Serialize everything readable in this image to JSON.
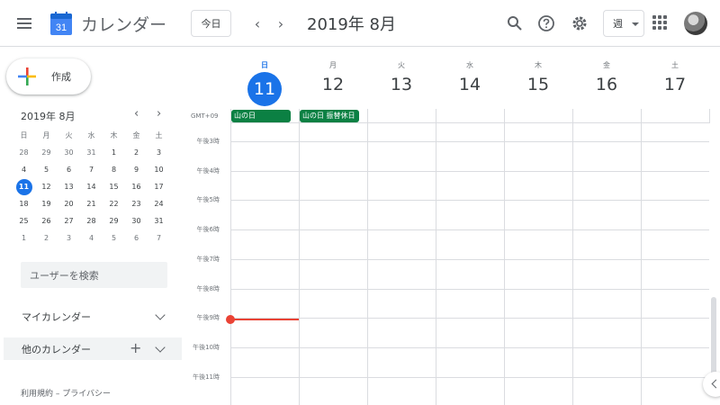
{
  "header": {
    "app_title": "カレンダー",
    "logo_day": "31",
    "today_label": "今日",
    "month_title": "2019年 8月",
    "view_label": "週",
    "logo_color": "#4285f4"
  },
  "sidebar": {
    "create_label": "作成",
    "mini_month": "2019年 8月",
    "weekdays": [
      "日",
      "月",
      "火",
      "水",
      "木",
      "金",
      "土"
    ],
    "weeks": [
      [
        "28",
        "29",
        "30",
        "31",
        "1",
        "2",
        "3"
      ],
      [
        "4",
        "5",
        "6",
        "7",
        "8",
        "9",
        "10"
      ],
      [
        "11",
        "12",
        "13",
        "14",
        "15",
        "16",
        "17"
      ],
      [
        "18",
        "19",
        "20",
        "21",
        "22",
        "23",
        "24"
      ],
      [
        "25",
        "26",
        "27",
        "28",
        "29",
        "30",
        "31"
      ],
      [
        "1",
        "2",
        "3",
        "4",
        "5",
        "6",
        "7"
      ]
    ],
    "today": "11",
    "search_placeholder": "ユーザーを検索",
    "my_calendars": "マイカレンダー",
    "other_calendars": "他のカレンダー",
    "footer": "利用規約 – プライバシー"
  },
  "week": {
    "days": [
      {
        "wd": "日",
        "dn": "11",
        "today": true
      },
      {
        "wd": "月",
        "dn": "12"
      },
      {
        "wd": "火",
        "dn": "13"
      },
      {
        "wd": "水",
        "dn": "14"
      },
      {
        "wd": "木",
        "dn": "15"
      },
      {
        "wd": "金",
        "dn": "16"
      },
      {
        "wd": "土",
        "dn": "17"
      }
    ],
    "timezone": "GMT+09",
    "allday_events": [
      {
        "title": "山の日",
        "day": 0,
        "color": "#0b8043"
      },
      {
        "title": "山の日 振替休日",
        "day": 1,
        "color": "#0b8043"
      }
    ],
    "hours": [
      "午後3時",
      "午後4時",
      "午後5時",
      "午後6時",
      "午後7時",
      "午後8時",
      "午後9時",
      "午後10時",
      "午後11時"
    ],
    "now_color": "#ea4335",
    "today_color": "#1a73e8"
  }
}
